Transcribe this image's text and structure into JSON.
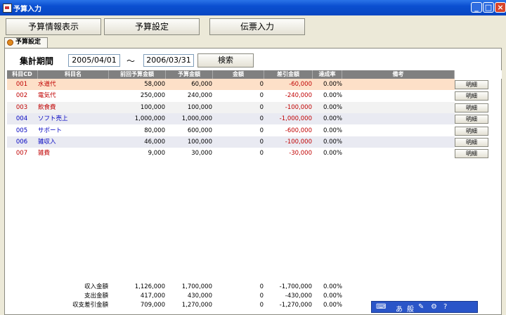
{
  "window": {
    "title": "予算入力",
    "min": "_",
    "max": "□",
    "close": "×"
  },
  "toolbar": {
    "info": "予算情報表示",
    "settings": "予算設定",
    "voucher": "伝票入力"
  },
  "tab": {
    "label": "予算設定"
  },
  "filter": {
    "period_label": "集計期間",
    "start": "2005/04/01",
    "separator": "～",
    "end": "2006/03/31",
    "search": "検索"
  },
  "columns": {
    "code": "科目CD",
    "name": "科目名",
    "prev_budget": "前回予算金額",
    "budget": "予算金額",
    "amount": "金額",
    "diff": "差引金額",
    "rate": "達成率",
    "notes": "備考"
  },
  "rows": [
    {
      "code": "001",
      "name": "水道代",
      "prev": "58,000",
      "budget": "60,000",
      "amount": "0",
      "diff": "-60,000",
      "rate": "0.00%",
      "detail": "明細"
    },
    {
      "code": "002",
      "name": "電気代",
      "prev": "250,000",
      "budget": "240,000",
      "amount": "0",
      "diff": "-240,000",
      "rate": "0.00%",
      "detail": "明細"
    },
    {
      "code": "003",
      "name": "飲食費",
      "prev": "100,000",
      "budget": "100,000",
      "amount": "0",
      "diff": "-100,000",
      "rate": "0.00%",
      "detail": "明細"
    },
    {
      "code": "004",
      "name": "ソフト売上",
      "prev": "1,000,000",
      "budget": "1,000,000",
      "amount": "0",
      "diff": "-1,000,000",
      "rate": "0.00%",
      "detail": "明細"
    },
    {
      "code": "005",
      "name": "サポート",
      "prev": "80,000",
      "budget": "600,000",
      "amount": "0",
      "diff": "-600,000",
      "rate": "0.00%",
      "detail": "明細"
    },
    {
      "code": "006",
      "name": "雑収入",
      "prev": "46,000",
      "budget": "100,000",
      "amount": "0",
      "diff": "-100,000",
      "rate": "0.00%",
      "detail": "明細"
    },
    {
      "code": "007",
      "name": "雑費",
      "prev": "9,000",
      "budget": "30,000",
      "amount": "0",
      "diff": "-30,000",
      "rate": "0.00%",
      "detail": "明細"
    }
  ],
  "summary": [
    {
      "label": "収入金額",
      "prev": "1,126,000",
      "budget": "1,700,000",
      "amount": "0",
      "diff": "-1,700,000",
      "rate": "0.00%"
    },
    {
      "label": "支出金額",
      "prev": "417,000",
      "budget": "430,000",
      "amount": "0",
      "diff": "-430,000",
      "rate": "0.00%"
    },
    {
      "label": "収支差引金額",
      "prev": "709,000",
      "budget": "1,270,000",
      "amount": "0",
      "diff": "-1,270,000",
      "rate": "0.00%"
    }
  ],
  "langbar": {
    "ime": "あ",
    "mode": "般"
  },
  "colors": {
    "expense_code": "#c00000",
    "income_code": "#0000c0",
    "negative": "#c00000",
    "selected_row": "#fde0c8",
    "header": "#808080"
  }
}
